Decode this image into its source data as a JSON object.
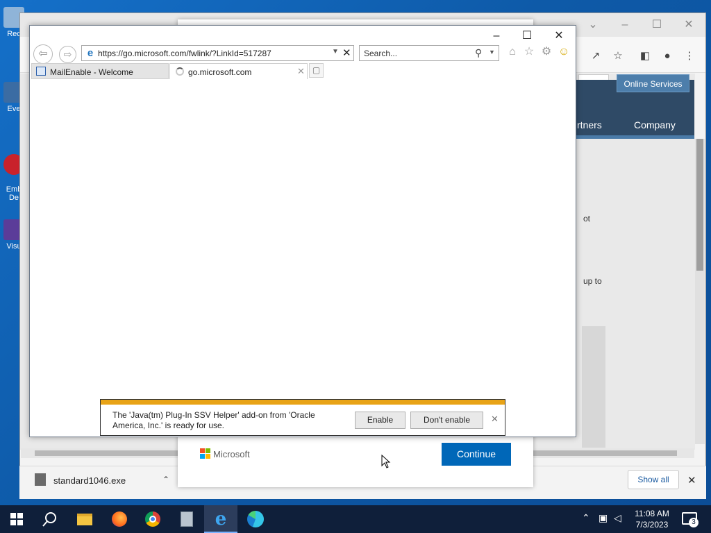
{
  "desktop": {
    "icons": [
      {
        "label": "Rec"
      },
      {
        "label": "Eve"
      },
      {
        "label": "Emb\nDe"
      },
      {
        "label": "Visu"
      }
    ]
  },
  "edge": {
    "online_services": "Online Services",
    "nav_partners": "rtners",
    "nav_company": "Company",
    "text_fragment_1": "ot",
    "text_fragment_2": "up to",
    "download_file": "standard1046.exe",
    "show_all": "Show all"
  },
  "ms_card": {
    "logo_text": "Microsoft",
    "continue_label": "Continue"
  },
  "ie": {
    "address": "https://go.microsoft.com/fwlink/?LinkId=517287",
    "search_placeholder": "Search...",
    "tabs": [
      {
        "label": "MailEnable - Welcome"
      },
      {
        "label": "go.microsoft.com"
      }
    ],
    "notification": {
      "message": "The 'Java(tm) Plug-In SSV Helper' add-on from 'Oracle America, Inc.' is ready for use.",
      "enable_label": "Enable",
      "dont_enable_label": "Don't enable"
    }
  },
  "taskbar": {
    "time": "11:08 AM",
    "date": "7/3/2023",
    "notification_count": "3"
  }
}
